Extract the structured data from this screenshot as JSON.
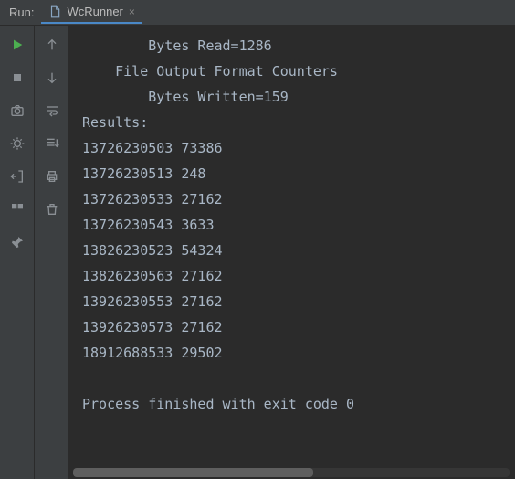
{
  "header": {
    "run_label": "Run:",
    "tab_label": "WcRunner"
  },
  "console": {
    "lines": [
      "        Bytes Read=1286",
      "    File Output Format Counters",
      "        Bytes Written=159",
      "Results:",
      "13726230503 73386",
      "13726230513 248",
      "13726230533 27162",
      "13726230543 3633",
      "13826230523 54324",
      "13826230563 27162",
      "13926230553 27162",
      "13926230573 27162",
      "18912688533 29502",
      "",
      "Process finished with exit code 0"
    ]
  },
  "left_icons": [
    "run",
    "stop",
    "camera",
    "bug",
    "export",
    "layout",
    "pin"
  ],
  "mid_icons": [
    "up",
    "down",
    "wrap",
    "scroll",
    "print",
    "trash"
  ]
}
